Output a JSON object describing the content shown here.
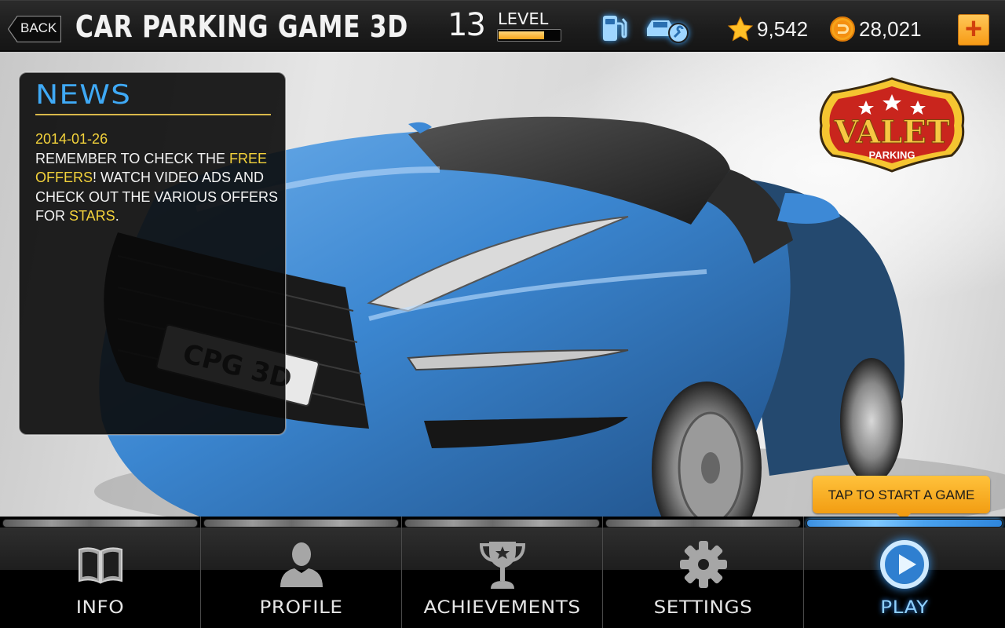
{
  "header": {
    "back_label": "BACK",
    "title": "CAR PARKING GAME 3D",
    "level": {
      "number": "13",
      "label": "LEVEL",
      "progress_percent": 72
    },
    "icons": [
      "fuel-station-icon",
      "car-service-icon"
    ],
    "stars": "9,542",
    "coins": "28,021",
    "add_currency_label": "+"
  },
  "news": {
    "title": "NEWS",
    "date": "2014-01-26",
    "text_parts": [
      {
        "text": "REMEMBER TO CHECK THE ",
        "highlight": false
      },
      {
        "text": "FREE OFFERS",
        "highlight": true
      },
      {
        "text": "! WATCH VIDEO ADS AND CHECK OUT THE VARIOUS OFFERS FOR ",
        "highlight": false
      },
      {
        "text": "STARS",
        "highlight": true
      },
      {
        "text": ".",
        "highlight": false
      }
    ]
  },
  "hero": {
    "license_plate": "CPG 3D",
    "badge": {
      "title": "VALET",
      "subtitle": "PARKING"
    }
  },
  "tooltip": {
    "text": "TAP TO START A GAME"
  },
  "nav": {
    "items": [
      {
        "label": "INFO",
        "icon": "book-icon",
        "active": false
      },
      {
        "label": "PROFILE",
        "icon": "person-icon",
        "active": false
      },
      {
        "label": "ACHIEVEMENTS",
        "icon": "trophy-icon",
        "active": false
      },
      {
        "label": "SETTINGS",
        "icon": "gear-icon",
        "active": false
      },
      {
        "label": "PLAY",
        "icon": "play-icon",
        "active": true
      }
    ]
  },
  "colors": {
    "accent_blue": "#3fa9f5",
    "highlight_yellow": "#f3d23b",
    "tooltip_orange": "#f7a41a",
    "news_rule": "#d9b84a",
    "badge_red": "#c9251d",
    "badge_gold": "#f5c531"
  }
}
